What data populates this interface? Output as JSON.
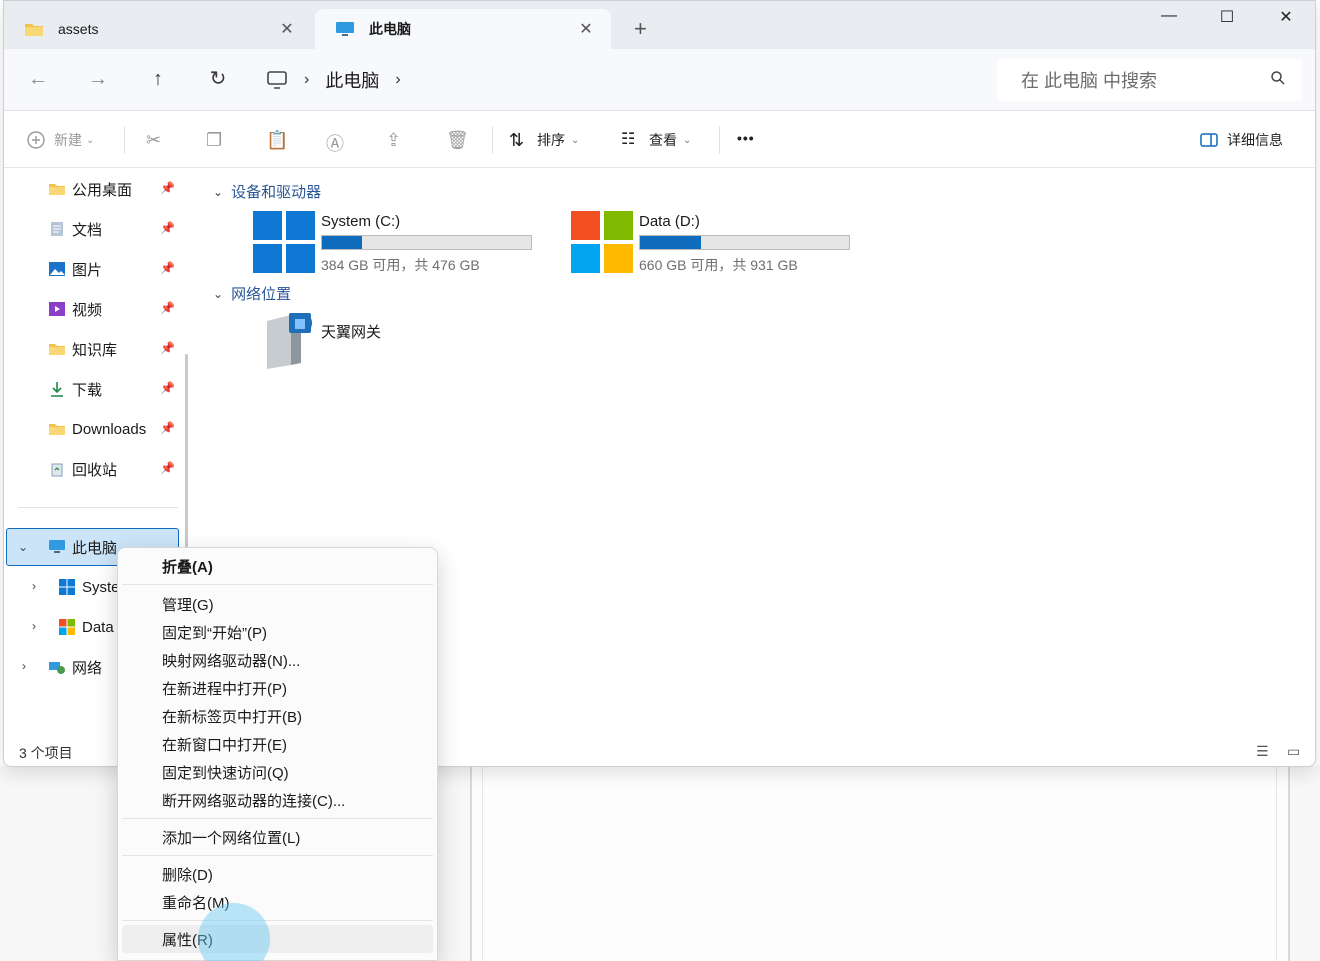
{
  "tabs": [
    {
      "label": "assets",
      "active": false
    },
    {
      "label": "此电脑",
      "active": true
    }
  ],
  "address": {
    "breadcrumb": [
      "此电脑"
    ],
    "search_placeholder": "在 此电脑 中搜索"
  },
  "commands": {
    "new": "新建",
    "sort": "排序",
    "view": "查看",
    "more": "•••",
    "details": "详细信息"
  },
  "sidebar": {
    "quick": [
      {
        "label": "公用桌面",
        "icon": "folder-icon"
      },
      {
        "label": "文档",
        "icon": "document-icon"
      },
      {
        "label": "图片",
        "icon": "pictures-icon"
      },
      {
        "label": "视频",
        "icon": "video-icon"
      },
      {
        "label": "知识库",
        "icon": "folder-icon"
      },
      {
        "label": "下载",
        "icon": "download-icon"
      },
      {
        "label": "Downloads",
        "icon": "folder-icon"
      },
      {
        "label": "回收站",
        "icon": "recycle-bin-icon"
      }
    ],
    "this_pc": "此电脑",
    "drives": [
      "Syste",
      "Data"
    ],
    "network": "网络"
  },
  "groups": {
    "devices": "设备和驱动器",
    "network": "网络位置"
  },
  "drives": [
    {
      "name": "System (C:)",
      "info": "384 GB 可用，共 476 GB",
      "used_fraction": 0.19,
      "logo": "windows"
    },
    {
      "name": "Data (D:)",
      "info": "660 GB 可用，共 931 GB",
      "used_fraction": 0.29,
      "logo": "multicolor"
    }
  ],
  "network_locations": [
    {
      "name": "天翼网关"
    }
  ],
  "status": {
    "count": "3 个项目"
  },
  "context_menu": {
    "items": [
      {
        "label": "折叠(A)",
        "bold": true
      },
      {
        "label": "管理(G)"
      },
      {
        "label": "固定到“开始”(P)"
      },
      {
        "label": "映射网络驱动器(N)..."
      },
      {
        "label": "在新进程中打开(P)"
      },
      {
        "label": "在新标签页中打开(B)"
      },
      {
        "label": "在新窗口中打开(E)"
      },
      {
        "label": "固定到快速访问(Q)"
      },
      {
        "label": "断开网络驱动器的连接(C)..."
      },
      {
        "label": "添加一个网络位置(L)"
      },
      {
        "label": "删除(D)"
      },
      {
        "label": "重命名(M)"
      },
      {
        "label": "属性(R)",
        "hover": true
      }
    ]
  },
  "colors": {
    "accent": "#0f6cbd",
    "selection": "#cce4f7"
  }
}
